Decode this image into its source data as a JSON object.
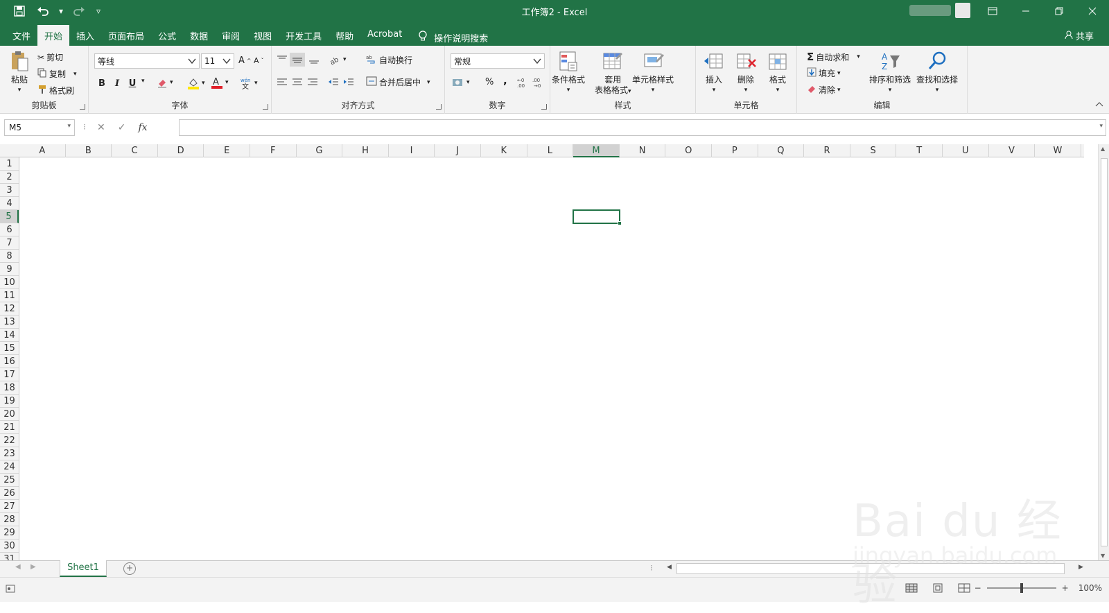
{
  "window": {
    "title": "工作簿2 - Excel"
  },
  "ribbon_tabs": [
    "文件",
    "开始",
    "插入",
    "页面布局",
    "公式",
    "数据",
    "审阅",
    "视图",
    "开发工具",
    "帮助",
    "Acrobat"
  ],
  "active_tab": "开始",
  "tell_me": "操作说明搜索",
  "share": "共享",
  "clipboard": {
    "paste": "粘贴",
    "cut": "剪切",
    "copy": "复制",
    "format_painter": "格式刷",
    "label": "剪贴板"
  },
  "font": {
    "name": "等线",
    "size": "11",
    "label": "字体",
    "bold": "B",
    "italic": "I",
    "underline": "U"
  },
  "alignment": {
    "wrap_text": "自动换行",
    "merge_center": "合并后居中",
    "label": "对齐方式"
  },
  "number": {
    "format": "常规",
    "percent": "%",
    "comma": ",",
    "label": "数字"
  },
  "styles": {
    "conditional": "条件格式",
    "table_line1": "套用",
    "table_line2": "表格格式",
    "cell_styles": "单元格样式",
    "label": "样式"
  },
  "cells": {
    "insert": "插入",
    "delete": "删除",
    "format": "格式",
    "label": "单元格"
  },
  "editing": {
    "autosum": "自动求和",
    "fill": "填充",
    "clear": "清除",
    "sort_filter": "排序和筛选",
    "find_select": "查找和选择",
    "label": "编辑"
  },
  "formula_bar": {
    "name_box": "M5",
    "fx": "fx",
    "formula": ""
  },
  "columns": [
    "A",
    "B",
    "C",
    "D",
    "E",
    "F",
    "G",
    "H",
    "I",
    "J",
    "K",
    "L",
    "M",
    "N",
    "O",
    "P",
    "Q",
    "R",
    "S",
    "T",
    "U",
    "V",
    "W"
  ],
  "rows": [
    "1",
    "2",
    "3",
    "4",
    "5",
    "6",
    "7",
    "8",
    "9",
    "10",
    "11",
    "12",
    "13",
    "14",
    "15",
    "16",
    "17",
    "18",
    "19",
    "20",
    "21",
    "22",
    "23",
    "24",
    "25",
    "26",
    "27",
    "28",
    "29",
    "30",
    "31"
  ],
  "selected_cell": {
    "column": "M",
    "row": "5"
  },
  "sheets": [
    "Sheet1"
  ],
  "status": {
    "zoom": "100%",
    "zoom_minus": "−",
    "zoom_plus": "+"
  },
  "watermark": {
    "main": "Bai du 经验",
    "sub": "jingyan.baidu.com"
  },
  "colors": {
    "brand": "#217346",
    "ribbon_bg": "#f3f3f3"
  }
}
